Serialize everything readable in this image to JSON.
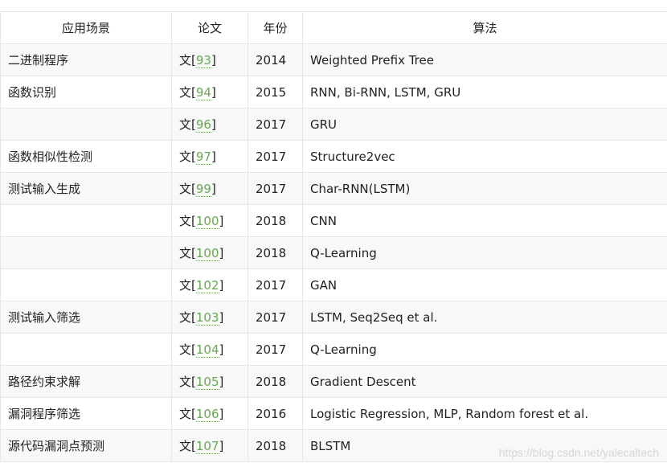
{
  "table": {
    "headers": [
      "应用场景",
      "论文",
      "年份",
      "算法"
    ],
    "rows": [
      {
        "scenario": "二进制程序",
        "cite_prefix": "文[",
        "ref": "93",
        "cite_suffix": "]",
        "year": "2014",
        "algorithm": "Weighted Prefix Tree"
      },
      {
        "scenario": "函数识别",
        "cite_prefix": "文[",
        "ref": "94",
        "cite_suffix": "]",
        "year": "2015",
        "algorithm": "RNN, Bi-RNN, LSTM, GRU"
      },
      {
        "scenario": "",
        "cite_prefix": "文[",
        "ref": "96",
        "cite_suffix": "]",
        "year": "2017",
        "algorithm": "GRU"
      },
      {
        "scenario": "函数相似性检测",
        "cite_prefix": "文[",
        "ref": "97",
        "cite_suffix": "]",
        "year": "2017",
        "algorithm": "Structure2vec"
      },
      {
        "scenario": "测试输入生成",
        "cite_prefix": "文[",
        "ref": "99",
        "cite_suffix": "]",
        "year": "2017",
        "algorithm": "Char-RNN(LSTM)"
      },
      {
        "scenario": "",
        "cite_prefix": "文[",
        "ref": "100",
        "cite_suffix": "]",
        "year": "2018",
        "algorithm": "CNN"
      },
      {
        "scenario": "",
        "cite_prefix": "文[",
        "ref": "100",
        "cite_suffix": "]",
        "year": "2018",
        "algorithm": "Q-Learning"
      },
      {
        "scenario": "",
        "cite_prefix": "文[",
        "ref": "102",
        "cite_suffix": "]",
        "year": "2017",
        "algorithm": "GAN"
      },
      {
        "scenario": "测试输入筛选",
        "cite_prefix": "文[",
        "ref": "103",
        "cite_suffix": "]",
        "year": "2017",
        "algorithm": "LSTM, Seq2Seq et al."
      },
      {
        "scenario": "",
        "cite_prefix": "文[",
        "ref": "104",
        "cite_suffix": "]",
        "year": "2017",
        "algorithm": "Q-Learning"
      },
      {
        "scenario": "路径约束求解",
        "cite_prefix": "文[",
        "ref": "105",
        "cite_suffix": "]",
        "year": "2018",
        "algorithm": "Gradient Descent"
      },
      {
        "scenario": "漏洞程序筛选",
        "cite_prefix": "文[",
        "ref": "106",
        "cite_suffix": "]",
        "year": "2016",
        "algorithm": "Logistic Regression, MLP, Random forest et al."
      },
      {
        "scenario": "源代码漏洞点预测",
        "cite_prefix": "文[",
        "ref": "107",
        "cite_suffix": "]",
        "year": "2018",
        "algorithm": "BLSTM"
      }
    ]
  },
  "watermark": "https://blog.csdn.net/yalecaltech",
  "colors": {
    "link": "#6aa84f",
    "border": "#e6e6e6",
    "stripe": "#f8f8f8"
  }
}
